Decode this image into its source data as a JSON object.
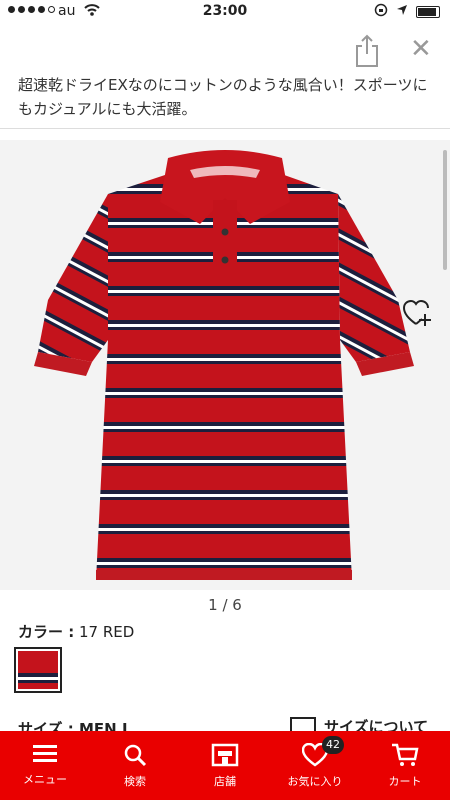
{
  "status_bar": {
    "carrier": "au",
    "time": "23:00"
  },
  "product": {
    "description": "超速乾ドライEXなのにコットンのような風合い！スポーツにもカジュアルにも大活躍。",
    "image_pager": "1 / 6",
    "color_label": "カラー :",
    "color_value": "17 RED",
    "size_label": "サイズ : MEN L",
    "size_guide_label": "サイズについて"
  },
  "bottom_nav": {
    "items": [
      {
        "label": "メニュー",
        "icon": "menu-icon"
      },
      {
        "label": "検索",
        "icon": "search-icon"
      },
      {
        "label": "店舗",
        "icon": "store-icon"
      },
      {
        "label": "お気に入り",
        "icon": "heart-icon",
        "badge": "42"
      },
      {
        "label": "カート",
        "icon": "cart-icon"
      }
    ]
  },
  "colors": {
    "brand_red": "#e90000",
    "shirt_red": "#c4131c",
    "stripe_navy": "#1d1f3d"
  }
}
